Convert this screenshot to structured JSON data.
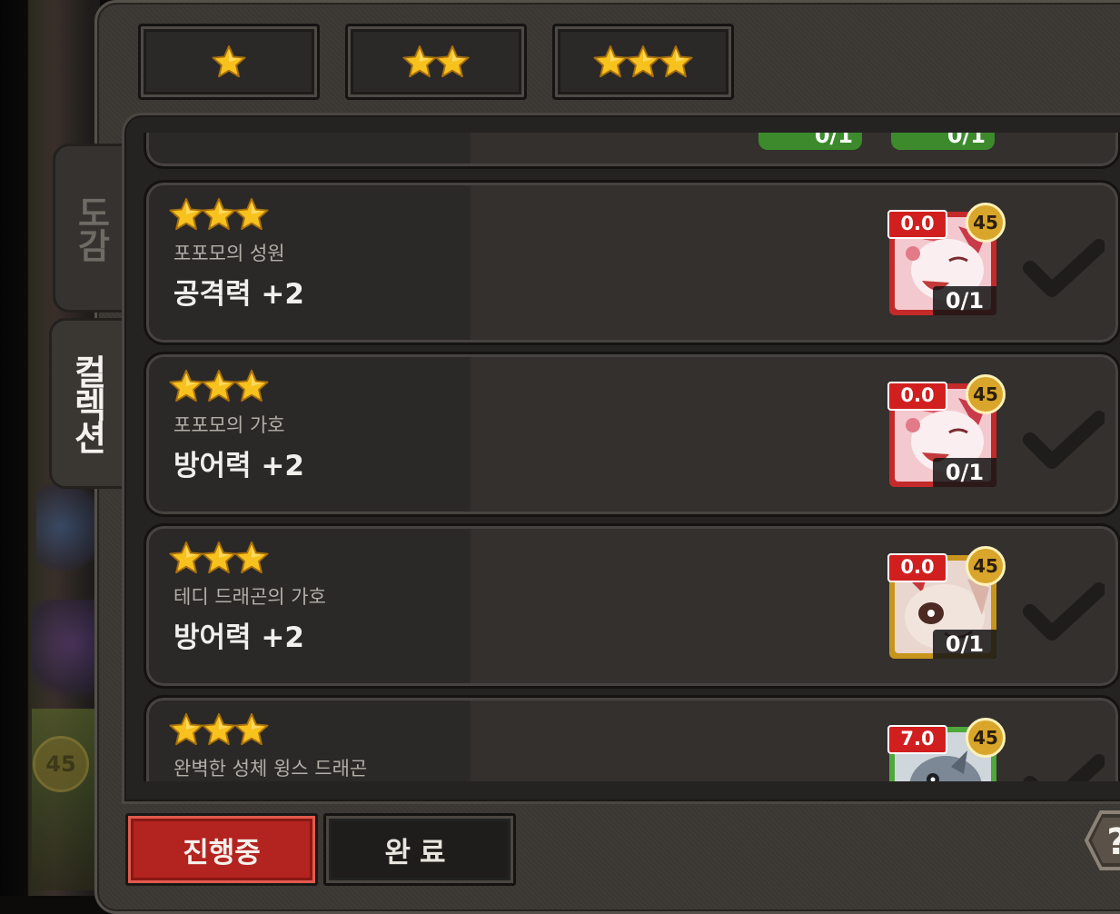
{
  "left_badge": "45",
  "filters": [
    {
      "stars": 1
    },
    {
      "stars": 2
    },
    {
      "stars": 3
    }
  ],
  "tabs": {
    "encyclopedia": "도감",
    "collection": "컬렉션"
  },
  "partial_top_card": {
    "counts": [
      "0/1",
      "0/1"
    ]
  },
  "cards": [
    {
      "stars": 3,
      "source": "포포모의 성원",
      "bonus": "공격력 +2",
      "unit": {
        "score": "0.0",
        "level": "45",
        "count": "0/1",
        "frame": "red",
        "character": "pink-fox"
      }
    },
    {
      "stars": 3,
      "source": "포포모의 가호",
      "bonus": "방어력 +2",
      "unit": {
        "score": "0.0",
        "level": "45",
        "count": "0/1",
        "frame": "red",
        "character": "pink-fox"
      }
    },
    {
      "stars": 3,
      "source": "테디 드래곤의 가호",
      "bonus": "방어력 +2",
      "unit": {
        "score": "0.0",
        "level": "45",
        "count": "0/1",
        "frame": "gold",
        "character": "teddy-dragon"
      }
    },
    {
      "stars": 3,
      "source": "완벽한 성체 윙스 드래곤",
      "bonus": "",
      "unit": {
        "score": "7.0",
        "level": "45",
        "count": "",
        "frame": "green",
        "character": "wings-dragon"
      }
    }
  ],
  "bottom": {
    "progress_label": "진행중",
    "done_label": "완료"
  },
  "help_label": "?",
  "colors": {
    "star": "#f7c21e",
    "active_button": "#b3231f",
    "frame": "#3b3834",
    "card": "#2b2927"
  }
}
